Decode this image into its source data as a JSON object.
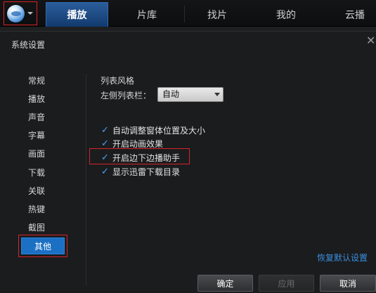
{
  "topbar": {
    "tabs": [
      {
        "label": "播放",
        "active": true
      },
      {
        "label": "片库",
        "active": false
      },
      {
        "label": "找片",
        "active": false
      },
      {
        "label": "我的",
        "active": false
      },
      {
        "label": "云播",
        "active": false
      }
    ]
  },
  "dialog": {
    "title": "系统设置",
    "close_glyph": "✕",
    "menu": {
      "items": [
        "常规",
        "播放",
        "声音",
        "字幕",
        "画面",
        "下载",
        "关联",
        "热键",
        "截图",
        "其他"
      ],
      "selected": "其他"
    },
    "list_style": {
      "section_title": "列表风格",
      "sidebar_label": "左侧列表栏：",
      "sidebar_value": "自动"
    },
    "options": [
      {
        "label": "自动调整窗体位置及大小",
        "checked": true
      },
      {
        "label": "开启动画效果",
        "checked": true
      },
      {
        "label": "开启边下边播助手",
        "checked": true
      },
      {
        "label": "显示迅雷下载目录",
        "checked": true
      }
    ],
    "restore_defaults": "恢复默认设置",
    "buttons": {
      "ok": "确定",
      "apply": "应用",
      "cancel": "取消"
    }
  },
  "colors": {
    "accent": "#1b70c4",
    "highlight_frame": "#d8232a",
    "link": "#3a8fe0"
  },
  "icons": {
    "logo": "player-logo-icon",
    "dropdown": "chevron-down-icon",
    "close": "close-icon",
    "check": "checkmark-icon"
  }
}
